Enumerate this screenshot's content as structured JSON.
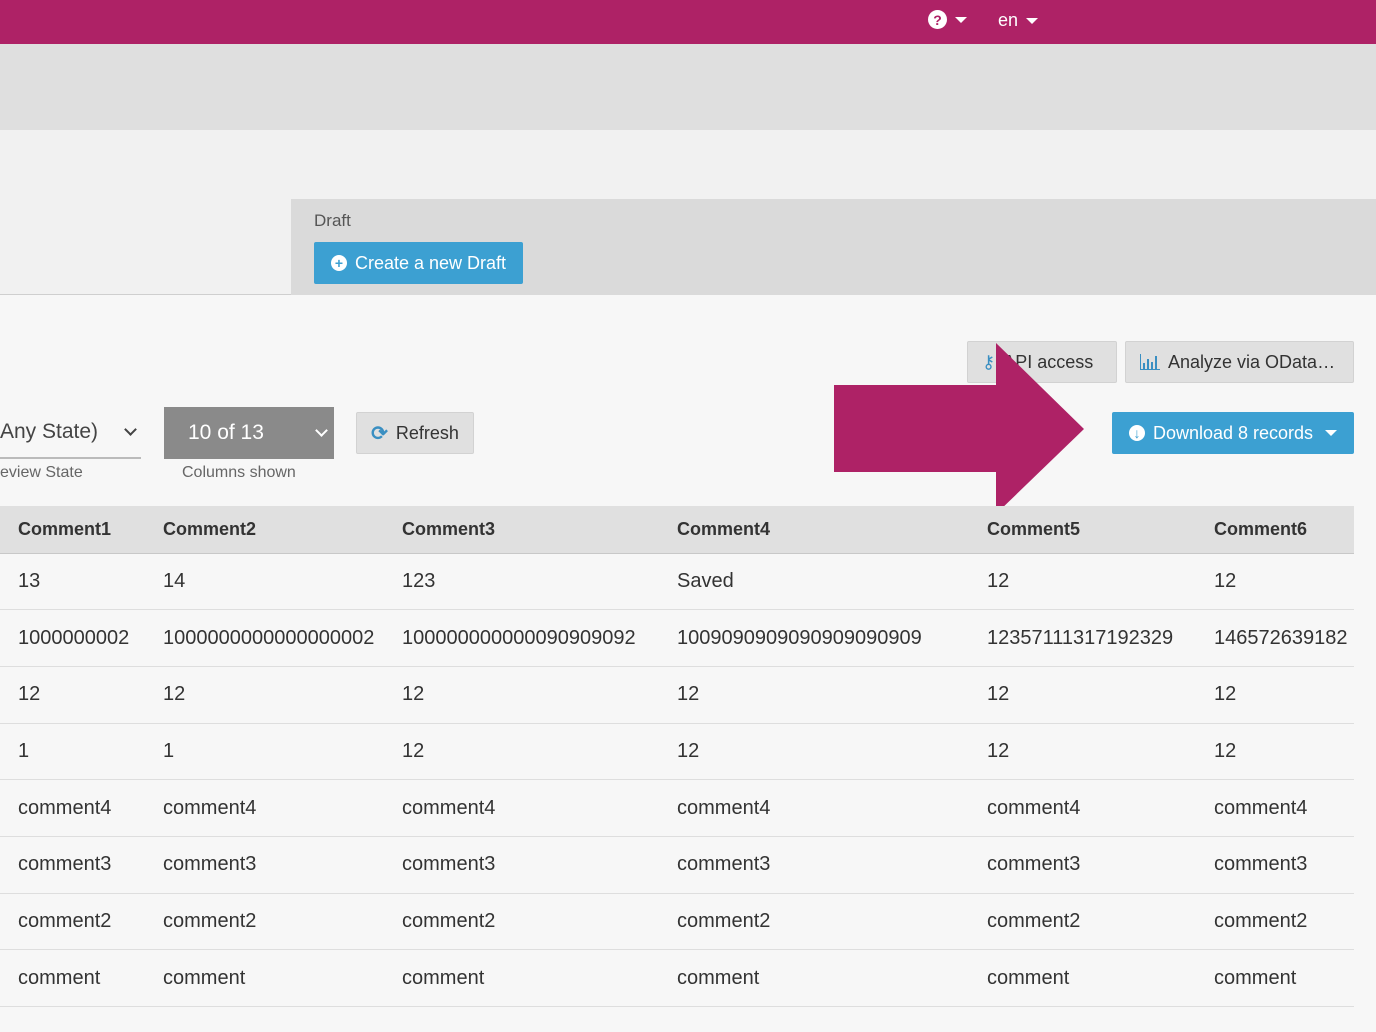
{
  "topbar": {
    "help_icon": "question-circle-icon",
    "language": "en",
    "background": "#ae2266"
  },
  "draft": {
    "label": "Draft",
    "create_button": "Create a new Draft"
  },
  "actions": {
    "api_access": "API access",
    "analyze_odata": "Analyze via OData…",
    "download": "Download 8 records"
  },
  "filters": {
    "state_value": "Any State)",
    "state_hint": "eview State",
    "columns_value": "10 of 13",
    "columns_hint": "Columns shown",
    "refresh": "Refresh"
  },
  "table": {
    "headers": [
      "Comment1",
      "Comment2",
      "Comment3",
      "Comment4",
      "Comment5",
      "Comment6"
    ],
    "rows": [
      [
        "13",
        "14",
        "123",
        "Saved",
        "12",
        "12"
      ],
      [
        "1000000002",
        "1000000000000000002",
        "100000000000090909092",
        "1009090909090909090909",
        "12357111317192329",
        "146572639182"
      ],
      [
        "12",
        "12",
        "12",
        "12",
        "12",
        "12"
      ],
      [
        "1",
        "1",
        "12",
        "12",
        "12",
        "12"
      ],
      [
        "comment4",
        "comment4",
        "comment4",
        "comment4",
        "comment4",
        "comment4"
      ],
      [
        "comment3",
        "comment3",
        "comment3",
        "comment3",
        "comment3",
        "comment3"
      ],
      [
        "comment2",
        "comment2",
        "comment2",
        "comment2",
        "comment2",
        "comment2"
      ],
      [
        "comment",
        "comment",
        "comment",
        "comment",
        "comment",
        "comment"
      ]
    ]
  },
  "colors": {
    "accent": "#ae2266",
    "primary_button": "#3ca0d2"
  }
}
